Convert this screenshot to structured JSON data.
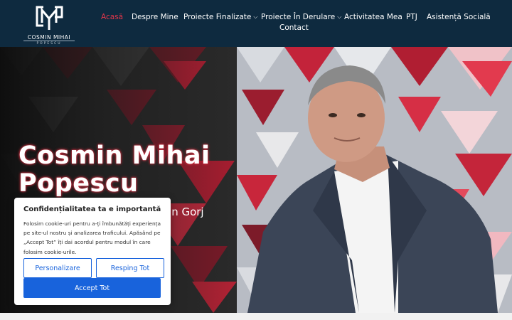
{
  "logo": {
    "mark": "CMP",
    "name": "COSMIN MIHAI",
    "sub": "POPESCU"
  },
  "nav": {
    "items": [
      {
        "label": "Acasă",
        "active": true
      },
      {
        "label": "Despre Mine"
      },
      {
        "label": "Proiecte Finalizate",
        "dropdown": true
      },
      {
        "label": "Proiecte În Derulare",
        "dropdown": true
      },
      {
        "label": "Activitatea Mea"
      },
      {
        "label": "PTJ"
      },
      {
        "label": "Asistență Socială"
      },
      {
        "label": "Contact"
      }
    ],
    "chevron": "⌵"
  },
  "hero": {
    "title_line1": "Cosmin Mihai",
    "title_line2": "Popescu",
    "subtitle_visible": "an Gorj"
  },
  "cookie": {
    "title": "Confidențialitatea ta e importantă",
    "text": "Folosim cookie-uri pentru a-ți îmbunătăți experiența pe site-ul nostru și analizarea traficului. Apăsând pe „Accept Tot” îți dai acordul pentru modul în care folosim cookie-urile.",
    "customize_label": "Personalizare",
    "reject_label": "Resping Tot",
    "accept_label": "Accept Tot"
  },
  "colors": {
    "header_bg": "#0e2a3f",
    "nav_active": "#e2364a",
    "button_blue": "#1863dc"
  }
}
